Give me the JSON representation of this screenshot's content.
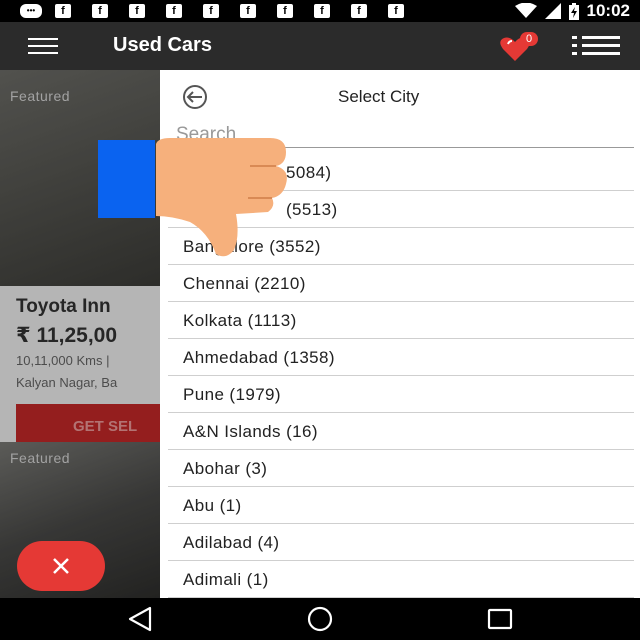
{
  "status_bar": {
    "time": "10:02",
    "notification_icons": [
      "message-icon",
      "facebook-icon",
      "facebook-icon",
      "facebook-icon",
      "facebook-icon",
      "facebook-icon",
      "facebook-icon",
      "facebook-icon",
      "facebook-icon",
      "facebook-icon",
      "facebook-icon"
    ],
    "notification_glyph": "f"
  },
  "app_bar": {
    "title": "Used Cars",
    "favorites_count": "0"
  },
  "background_listing": {
    "featured_label": "Featured",
    "car_name": "Toyota Inn",
    "price": "₹ 11,25,00",
    "kms": "10,11,000 Kms  |",
    "location": "Kalyan Nagar, Ba",
    "seller_button": "GET SEL",
    "featured_label_2": "Featured"
  },
  "city_drawer": {
    "title": "Select City",
    "search_placeholder": "Search",
    "cities": [
      {
        "label": "5084)"
      },
      {
        "label": "(5513)"
      },
      {
        "label": "Bangalore (3552)"
      },
      {
        "label": "Chennai (2210)"
      },
      {
        "label": "Kolkata (1113)"
      },
      {
        "label": "Ahmedabad (1358)"
      },
      {
        "label": "Pune (1979)"
      },
      {
        "label": "A&N Islands (16)"
      },
      {
        "label": "Abohar (3)"
      },
      {
        "label": "Abu (1)"
      },
      {
        "label": "Adilabad (4)"
      },
      {
        "label": "Adimali (1)"
      }
    ]
  },
  "colors": {
    "app_bar": "#2b2b2b",
    "accent_red": "#e53935",
    "overlay_blue": "#0a63f0",
    "thumb": "#f6b07c"
  },
  "icons": {
    "menu": "hamburger-icon",
    "favorites": "heart-icon",
    "list": "list-icon",
    "back": "back-arrow-icon",
    "close": "close-icon",
    "nav_back": "triangle-back-icon",
    "nav_home": "circle-home-icon",
    "nav_recents": "square-recents-icon"
  }
}
